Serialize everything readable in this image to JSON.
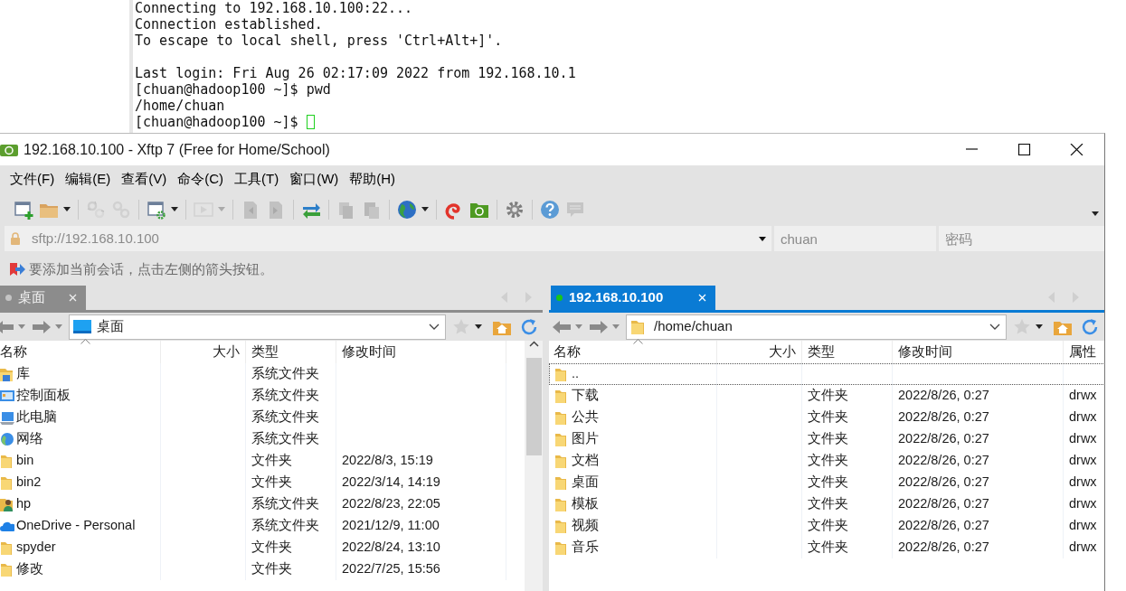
{
  "terminal": {
    "blocks": [
      [
        "Connecting to 192.168.10.100:22...",
        "Connection established.",
        "To escape to local shell, press 'Ctrl+Alt+]'."
      ],
      [
        "Last login: Fri Aug 26 02:17:09 2022 from 192.168.10.1",
        "[chuan@hadoop100 ~]$ pwd",
        "/home/chuan",
        "[chuan@hadoop100 ~]$"
      ]
    ],
    "cursor": true
  },
  "window": {
    "title": "192.168.10.100 - Xftp 7 (Free for Home/School)"
  },
  "menu": [
    "文件(F)",
    "编辑(E)",
    "查看(V)",
    "命令(C)",
    "工具(T)",
    "窗口(W)",
    "帮助(H)"
  ],
  "toolbar": [
    {
      "kind": "new",
      "disabled": false,
      "dropdown": false
    },
    {
      "kind": "open",
      "disabled": false,
      "dropdown": true
    },
    {
      "kind": "separator"
    },
    {
      "kind": "disconnect",
      "disabled": true,
      "dropdown": false
    },
    {
      "kind": "reconnect",
      "disabled": true,
      "dropdown": false
    },
    {
      "kind": "separator"
    },
    {
      "kind": "properties",
      "disabled": false,
      "dropdown": true
    },
    {
      "kind": "separator"
    },
    {
      "kind": "play",
      "disabled": true,
      "dropdown": true
    },
    {
      "kind": "separator"
    },
    {
      "kind": "upload",
      "disabled": true,
      "dropdown": false
    },
    {
      "kind": "download",
      "disabled": true,
      "dropdown": false
    },
    {
      "kind": "separator"
    },
    {
      "kind": "transfer",
      "disabled": false,
      "dropdown": false
    },
    {
      "kind": "separator"
    },
    {
      "kind": "copy",
      "disabled": true,
      "dropdown": false
    },
    {
      "kind": "paste",
      "disabled": true,
      "dropdown": false
    },
    {
      "kind": "separator"
    },
    {
      "kind": "globe",
      "disabled": false,
      "dropdown": true
    },
    {
      "kind": "separator"
    },
    {
      "kind": "swirl",
      "disabled": false,
      "dropdown": false
    },
    {
      "kind": "folder",
      "disabled": false,
      "dropdown": false
    },
    {
      "kind": "separator"
    },
    {
      "kind": "settings",
      "disabled": false,
      "dropdown": false
    },
    {
      "kind": "separator"
    },
    {
      "kind": "help",
      "disabled": false,
      "dropdown": false
    },
    {
      "kind": "chat",
      "disabled": true,
      "dropdown": false
    }
  ],
  "address_bar": {
    "url": "sftp://192.168.10.100",
    "username": "chuan",
    "password_placeholder": "密码"
  },
  "hint": "要添加当前会话，点击左侧的箭头按钮。",
  "panes": [
    {
      "tab": {
        "label": "桌面",
        "selected": false,
        "connected": false
      },
      "path": {
        "kind": "desktop",
        "text": "桌面"
      },
      "scrollbar": true,
      "columns": [
        {
          "label": "名称",
          "sorted": true
        },
        {
          "label": "大小",
          "sorted": false
        },
        {
          "label": "类型",
          "sorted": false
        },
        {
          "label": "修改时间",
          "sorted": false
        }
      ],
      "rows": [
        {
          "kind": "library",
          "focused": false,
          "cells": [
            "库",
            "",
            "系统文件夹",
            ""
          ]
        },
        {
          "kind": "control-panel",
          "focused": false,
          "cells": [
            "控制面板",
            "",
            "系统文件夹",
            ""
          ]
        },
        {
          "kind": "computer",
          "focused": false,
          "cells": [
            "此电脑",
            "",
            "系统文件夹",
            ""
          ]
        },
        {
          "kind": "network",
          "focused": false,
          "cells": [
            "网络",
            "",
            "系统文件夹",
            ""
          ]
        },
        {
          "kind": "folder",
          "focused": false,
          "cells": [
            "bin",
            "",
            "文件夹",
            "2022/8/3, 15:19"
          ]
        },
        {
          "kind": "folder",
          "focused": false,
          "cells": [
            "bin2",
            "",
            "文件夹",
            "2022/3/14, 14:19"
          ]
        },
        {
          "kind": "user",
          "focused": false,
          "cells": [
            "hp",
            "",
            "系统文件夹",
            "2022/8/23, 22:05"
          ]
        },
        {
          "kind": "cloud",
          "focused": false,
          "cells": [
            "OneDrive - Personal",
            "",
            "系统文件夹",
            "2021/12/9, 11:00"
          ]
        },
        {
          "kind": "folder",
          "focused": false,
          "cells": [
            "spyder",
            "",
            "文件夹",
            "2022/8/24, 13:10"
          ]
        },
        {
          "kind": "folder",
          "focused": false,
          "cells": [
            "修改",
            "",
            "文件夹",
            "2022/7/25, 15:56"
          ]
        }
      ]
    },
    {
      "tab": {
        "label": "192.168.10.100",
        "selected": true,
        "connected": true
      },
      "path": {
        "kind": "folder",
        "text": "/home/chuan"
      },
      "scrollbar": false,
      "columns": [
        {
          "label": "名称",
          "sorted": true
        },
        {
          "label": "大小",
          "sorted": false
        },
        {
          "label": "类型",
          "sorted": false
        },
        {
          "label": "修改时间",
          "sorted": false
        },
        {
          "label": "属性",
          "sorted": false
        }
      ],
      "rows": [
        {
          "kind": "folder",
          "focused": true,
          "cells": [
            "..",
            "",
            "",
            "",
            ""
          ]
        },
        {
          "kind": "folder",
          "focused": false,
          "cells": [
            "下载",
            "",
            "文件夹",
            "2022/8/26, 0:27",
            "drwx"
          ]
        },
        {
          "kind": "folder",
          "focused": false,
          "cells": [
            "公共",
            "",
            "文件夹",
            "2022/8/26, 0:27",
            "drwx"
          ]
        },
        {
          "kind": "folder",
          "focused": false,
          "cells": [
            "图片",
            "",
            "文件夹",
            "2022/8/26, 0:27",
            "drwx"
          ]
        },
        {
          "kind": "folder",
          "focused": false,
          "cells": [
            "文档",
            "",
            "文件夹",
            "2022/8/26, 0:27",
            "drwx"
          ]
        },
        {
          "kind": "folder",
          "focused": false,
          "cells": [
            "桌面",
            "",
            "文件夹",
            "2022/8/26, 0:27",
            "drwx"
          ]
        },
        {
          "kind": "folder",
          "focused": false,
          "cells": [
            "模板",
            "",
            "文件夹",
            "2022/8/26, 0:27",
            "drwx"
          ]
        },
        {
          "kind": "folder",
          "focused": false,
          "cells": [
            "视频",
            "",
            "文件夹",
            "2022/8/26, 0:27",
            "drwx"
          ]
        },
        {
          "kind": "folder",
          "focused": false,
          "cells": [
            "音乐",
            "",
            "文件夹",
            "2022/8/26, 0:27",
            "drwx"
          ]
        }
      ]
    }
  ]
}
